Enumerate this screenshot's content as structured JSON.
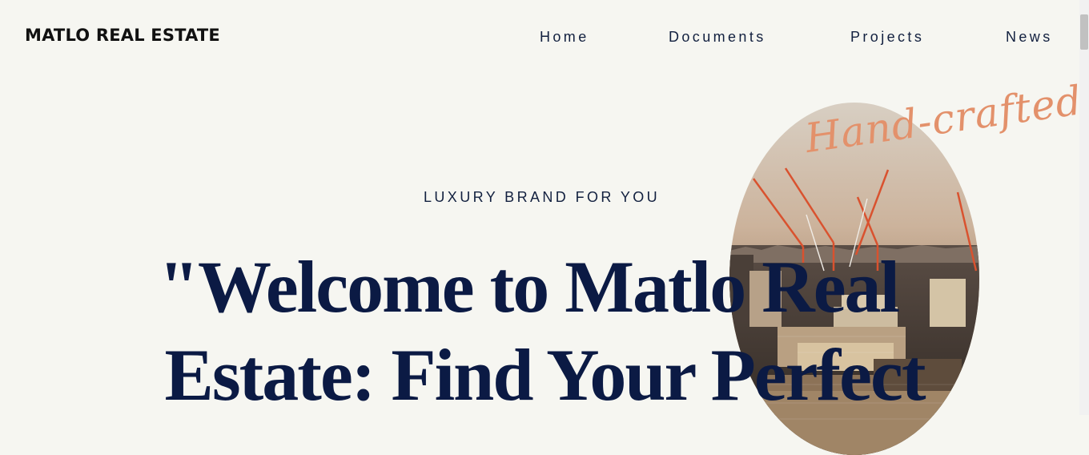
{
  "brand": "MATLO REAL ESTATE",
  "nav": {
    "home": "Home",
    "documents": "Documents",
    "projects": "Projects",
    "news": "News"
  },
  "hero": {
    "tagline": "LUXURY BRAND FOR YOU",
    "headline_line1": "\"Welcome to Matlo Real",
    "headline_line2": "Estate: Find Your Perfect",
    "script_text": "Hand-crafted"
  },
  "colors": {
    "background": "#f6f6f1",
    "headline": "#0b1a44",
    "script_accent": "#e3916b"
  }
}
